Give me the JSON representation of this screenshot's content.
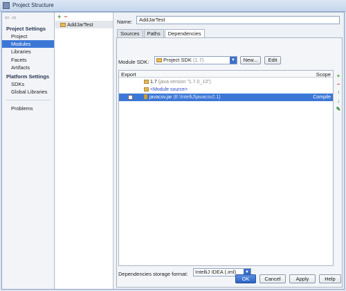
{
  "window": {
    "title": "Project Structure"
  },
  "nav": {
    "project_settings_header": "Project Settings",
    "project_settings": [
      {
        "label": "Project",
        "selected": false
      },
      {
        "label": "Modules",
        "selected": true
      },
      {
        "label": "Libraries",
        "selected": false
      },
      {
        "label": "Facets",
        "selected": false
      },
      {
        "label": "Artifacts",
        "selected": false
      }
    ],
    "platform_settings_header": "Platform Settings",
    "platform_settings": [
      {
        "label": "SDKs"
      },
      {
        "label": "Global Libraries"
      }
    ],
    "problems": "Problems"
  },
  "modules": {
    "add_label": "+",
    "remove_label": "−",
    "items": [
      "AddJarTest"
    ]
  },
  "content": {
    "name_label": "Name:",
    "name_value": "AddJarTest",
    "tabs": [
      {
        "label": "Sources",
        "active": false
      },
      {
        "label": "Paths",
        "active": false
      },
      {
        "label": "Dependencies",
        "active": true
      }
    ],
    "sdk_label": "Module SDK:",
    "sdk_value": "Project SDK",
    "sdk_version": "(1.7)",
    "new_button": "New...",
    "edit_button": "Edit",
    "table": {
      "export_header": "Export",
      "scope_header": "Scope",
      "rows": [
        {
          "name": "1.7",
          "detail": "(java version \"1.7.0_13\")",
          "scope": "",
          "has_checkbox": false,
          "selected": false
        },
        {
          "name": "<Module source>",
          "detail": "",
          "scope": "",
          "has_checkbox": false,
          "selected": false
        },
        {
          "name": "javacsv.jar",
          "detail": "(E:\\IntelliJ\\javacsv2.1)",
          "scope": "Compile",
          "has_checkbox": true,
          "selected": true
        }
      ]
    },
    "side_tools": [
      "+",
      "−",
      "↑",
      "↓",
      "✎"
    ],
    "storage_format_label": "Dependencies storage format:",
    "storage_format_value": "IntelliJ IDEA (.iml)"
  },
  "footer": {
    "ok": "OK",
    "cancel": "Cancel",
    "apply": "Apply",
    "help": "Help"
  }
}
